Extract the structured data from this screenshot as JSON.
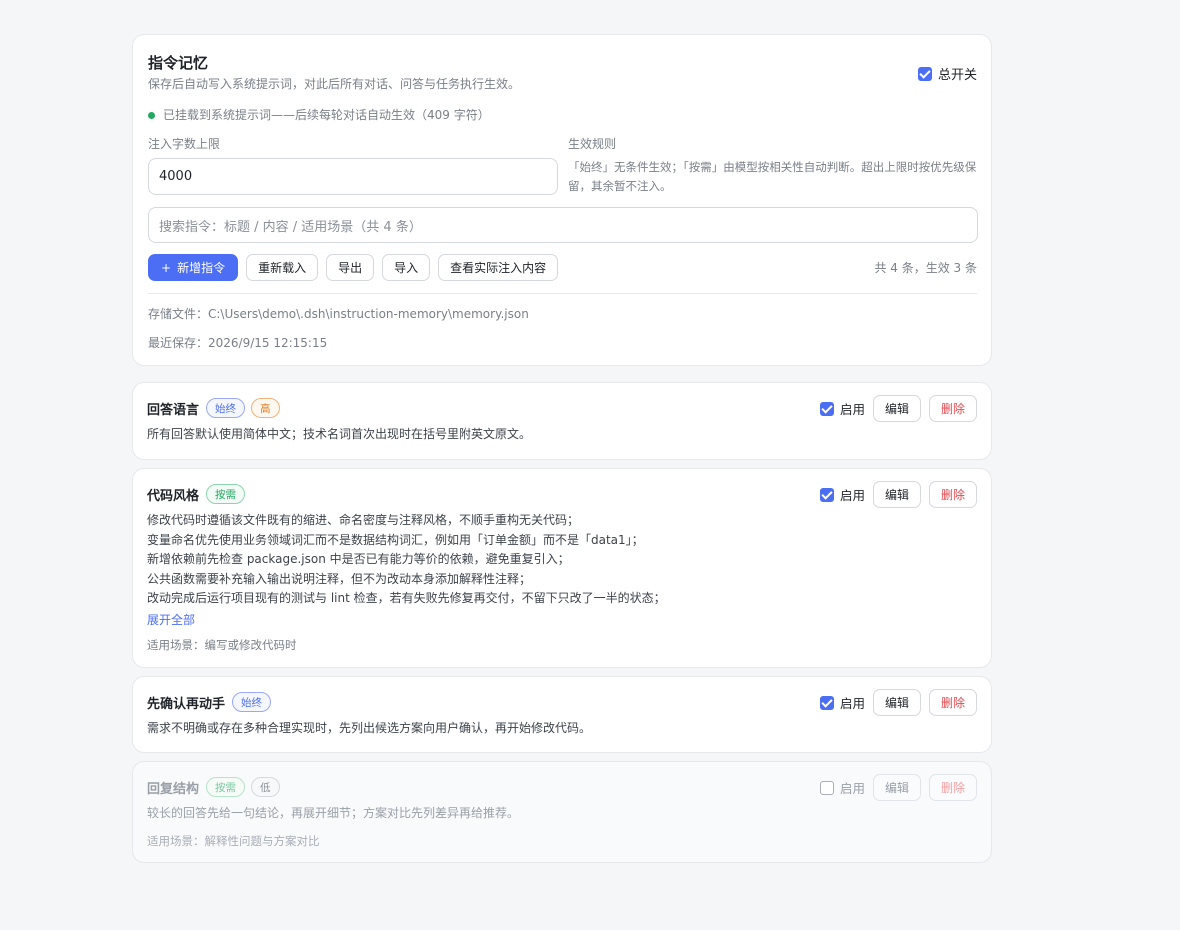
{
  "settings": {
    "title": "指令记忆",
    "description": "保存后自动写入系统提示词，对此后所有对话、问答与任务执行生效。",
    "master_switch_label": "总开关",
    "master_switch_on": true,
    "status_text": "已挂载到系统提示词——后续每轮对话自动生效（409 字符）",
    "limit_label": "注入字数上限",
    "limit_value": "4000",
    "rule_label": "生效规则",
    "rule_text": "「始终」无条件生效；「按需」由模型按相关性自动判断。超出上限时按优先级保留，其余暂不注入。",
    "search_placeholder": "搜索指令：标题 / 内容 / 适用场景（共 4 条）",
    "buttons": {
      "add": "新增指令",
      "reload": "重新载入",
      "export": "导出",
      "import": "导入",
      "view_injected": "查看实际注入内容"
    },
    "count_text": "共 4 条，生效 3 条",
    "file_text": "存储文件：C:\\Users\\demo\\.dsh\\instruction-memory\\memory.json",
    "saved_text": "最近保存：2026/9/15 12:15:15"
  },
  "item_labels": {
    "enable": "启用",
    "edit": "编辑",
    "delete": "删除",
    "expand_all": "展开全部"
  },
  "items": [
    {
      "title": "回答语言",
      "mode_tag": "始终",
      "priority_tag": "高",
      "enabled": true,
      "lines": [
        "所有回答默认使用简体中文；技术名词首次出现时在括号里附英文原文。"
      ]
    },
    {
      "title": "代码风格",
      "mode_tag": "按需",
      "enabled": true,
      "lines": [
        "修改代码时遵循该文件既有的缩进、命名密度与注释风格，不顺手重构无关代码；",
        "变量命名优先使用业务领域词汇而不是数据结构词汇，例如用「订单金额」而不是「data1」；",
        "新增依赖前先检查 package.json 中是否已有能力等价的依赖，避免重复引入；",
        "公共函数需要补充输入输出说明注释，但不为改动本身添加解释性注释；",
        "改动完成后运行项目现有的测试与 lint 检查，若有失败先修复再交付，不留下只改了一半的状态；"
      ],
      "scene": "适用场景：编写或修改代码时"
    },
    {
      "title": "先确认再动手",
      "mode_tag": "始终",
      "enabled": true,
      "lines": [
        "需求不明确或存在多种合理实现时，先列出候选方案向用户确认，再开始修改代码。"
      ]
    },
    {
      "title": "回复结构",
      "mode_tag": "按需",
      "priority_tag": "低",
      "enabled": false,
      "lines": [
        "较长的回答先给一句结论，再展开细节；方案对比先列差异再给推荐。"
      ],
      "scene": "适用场景：解释性问题与方案对比"
    }
  ],
  "colors": {
    "accent": "#4c6ef5",
    "success": "#22a861",
    "danger": "#e5484d",
    "warning": "#e07b1d"
  }
}
